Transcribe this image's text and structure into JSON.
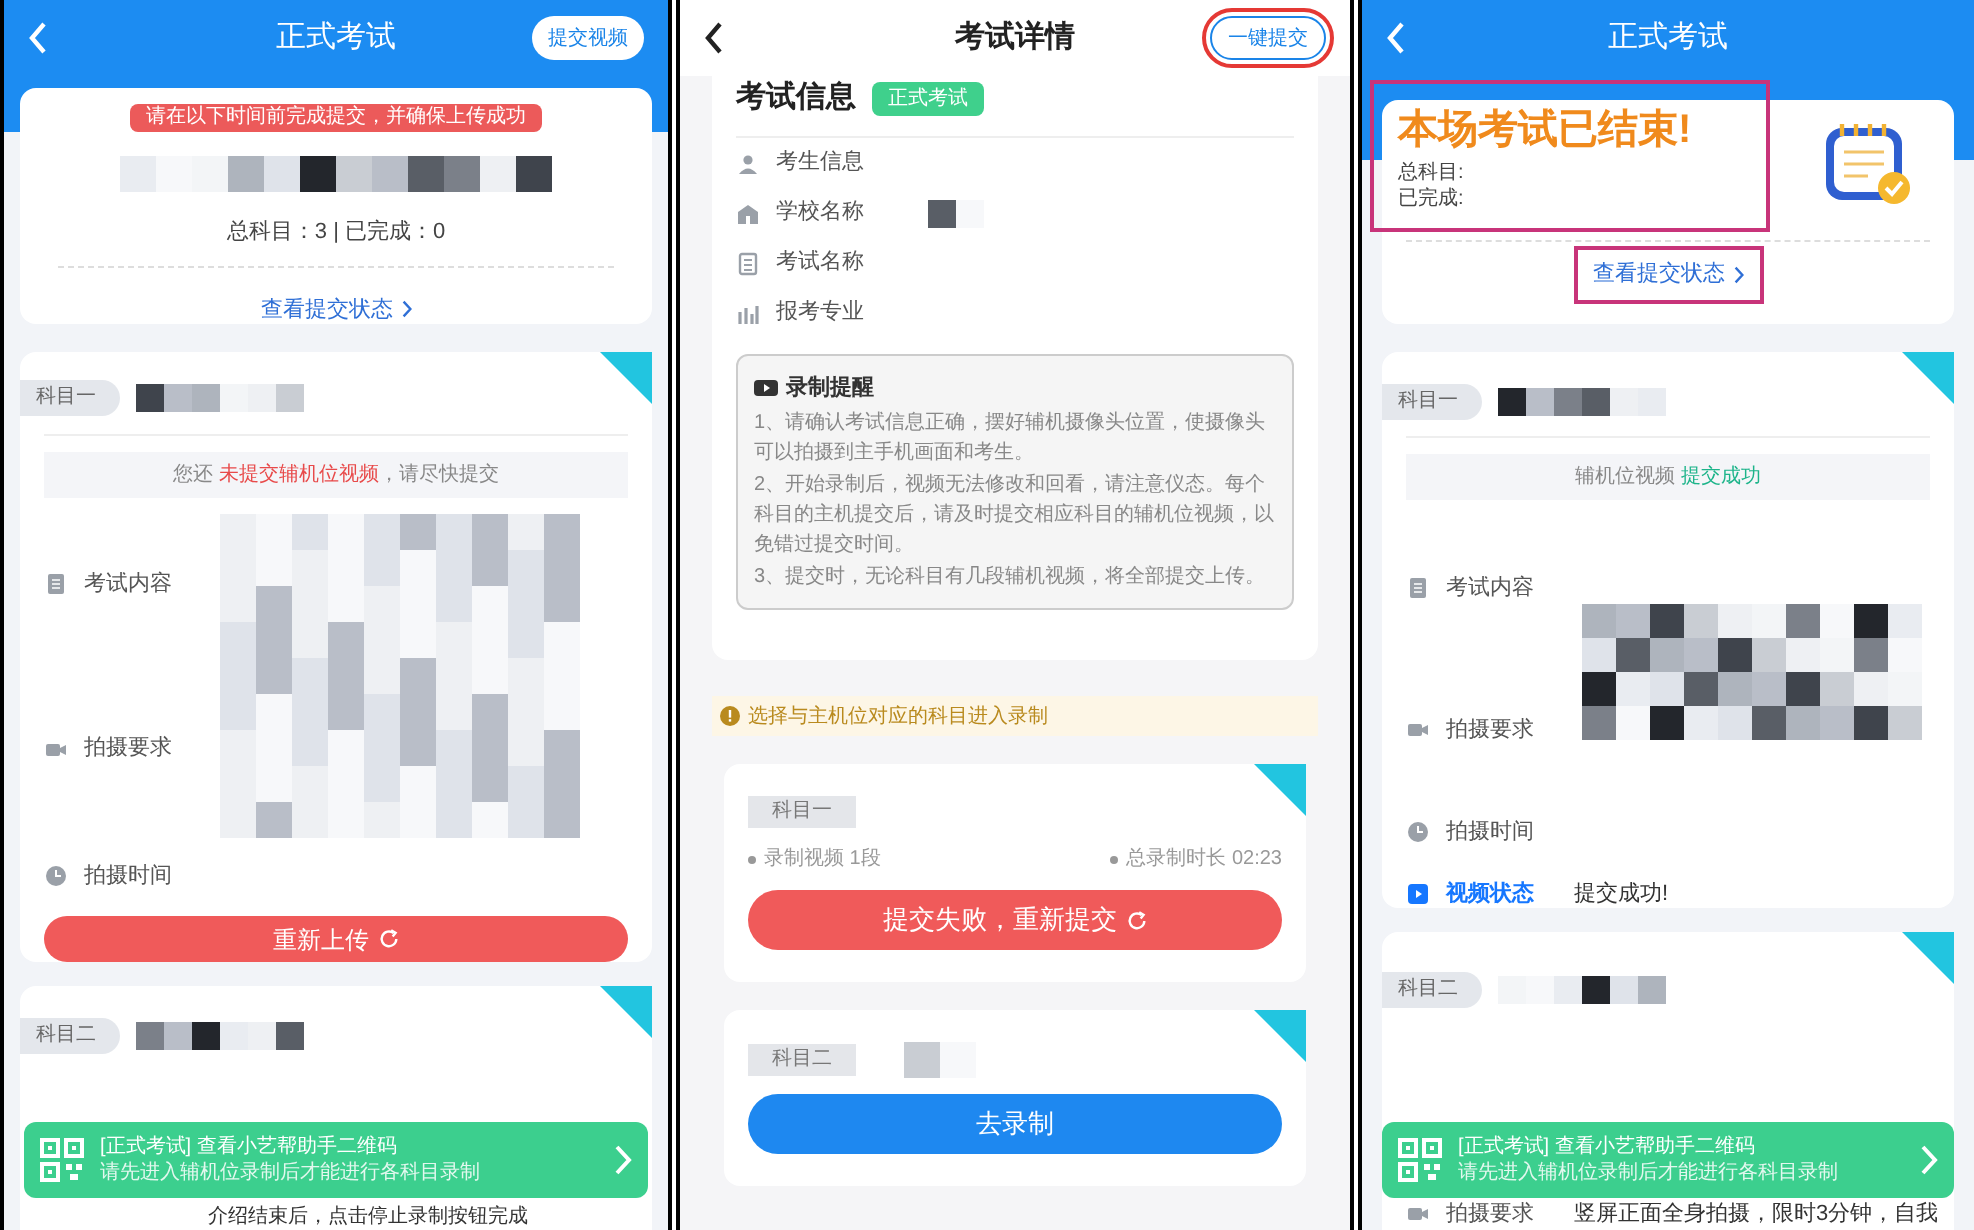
{
  "panels": [
    {
      "kind": "exam_pending",
      "header": {
        "title": "正式考试",
        "action": {
          "label": "提交视频"
        }
      },
      "summary": {
        "deadline_tip": "请在以下时间前完成提交，并确保上传成功",
        "counts": "总科目：3 | 已完成：0",
        "link": {
          "label": "查看提交状态"
        }
      },
      "subjects": [
        {
          "tag": "科目一",
          "notice": [
            {
              "text": "您还 ",
              "kind": "plain"
            },
            {
              "text": "未提交辅机位视频",
              "kind": "alert"
            },
            {
              "text": "，请尽快提交",
              "kind": "plain"
            }
          ],
          "fields": [
            {
              "kind": "content",
              "label": "考试内容"
            },
            {
              "kind": "requirement",
              "label": "拍摄要求"
            },
            {
              "kind": "time",
              "label": "拍摄时间"
            }
          ],
          "button": {
            "label": "重新上传",
            "kind": "danger"
          }
        },
        {
          "tag": "科目二",
          "text": "介绍结束后，点击停止录制按钮完成"
        }
      ],
      "banner": {
        "title": "[正式考试] 查看小艺帮助手二维码",
        "subtitle": "请先进入辅机位录制后才能进行各科目录制"
      }
    },
    {
      "kind": "exam_details",
      "header": {
        "title": "考试详情",
        "action": {
          "label": "一键提交",
          "annotated": true
        }
      },
      "info": {
        "heading": "考试信息",
        "badge": "正式考试",
        "fields": [
          {
            "kind": "student",
            "label": "考生信息"
          },
          {
            "kind": "school",
            "label": "学校名称"
          },
          {
            "kind": "exam",
            "label": "考试名称"
          },
          {
            "kind": "major",
            "label": "报考专业"
          }
        ],
        "reminder": {
          "title": "录制提醒",
          "items": [
            "1、请确认考试信息正确，摆好辅机摄像头位置，使摄像头可以拍摄到主手机画面和考生。",
            "2、开始录制后，视频无法修改和回看，请注意仪态。每个科目的主机提交后，请及时提交相应科目的辅机位视频，以免错过提交时间。",
            "3、提交时，无论科目有几段辅机视频，将全部提交上传。"
          ]
        }
      },
      "tip": "选择与主机位对应的科目进入录制",
      "subjects": [
        {
          "tag": "科目一",
          "stats": [
            "录制视频 1段",
            "总录制时长 02:23"
          ],
          "button": {
            "label": "提交失败，重新提交",
            "kind": "danger"
          }
        },
        {
          "tag": "科目二",
          "button": {
            "label": "去录制",
            "kind": "primary"
          }
        }
      ]
    },
    {
      "kind": "exam_ended",
      "header": {
        "title": "正式考试"
      },
      "ended": {
        "title": "本场考试已结束!",
        "total_label": "总科目:",
        "done_label": "已完成:",
        "annotated": true
      },
      "summary": {
        "link": {
          "label": "查看提交状态",
          "annotated": true
        }
      },
      "subjects": [
        {
          "tag": "科目一",
          "notice": [
            {
              "text": "辅机位视频 ",
              "kind": "plain"
            },
            {
              "text": "提交成功",
              "kind": "success"
            }
          ],
          "fields": [
            {
              "kind": "content",
              "label": "考试内容"
            },
            {
              "kind": "requirement",
              "label": "拍摄要求"
            },
            {
              "kind": "time",
              "label": "拍摄时间"
            },
            {
              "kind": "status",
              "label": "视频状态",
              "value": "提交成功!"
            }
          ]
        },
        {
          "tag": "科目二",
          "fields": [
            {
              "kind": "requirement",
              "label": "拍摄要求",
              "value": "竖屏正面全身拍摄，限时3分钟，自我"
            }
          ]
        }
      ],
      "banner": {
        "title": "[正式考试] 查看小艺帮助手二维码",
        "subtitle": "请先进入辅机位录制后才能进行各科目录制"
      }
    }
  ]
}
